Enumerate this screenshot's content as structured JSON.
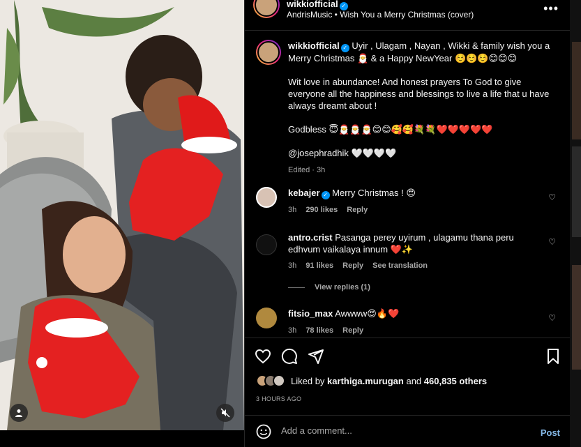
{
  "header": {
    "username": "wikkiofficial",
    "audio": "AndrisMusic • Wish You a Merry Christmas (cover)",
    "more_icon": "more-horizontal-icon"
  },
  "caption": {
    "username": "wikkiofficial",
    "line1": "Uyir , Ulagam , Nayan , Wikki & family wish you a Merry Christmas 🎅 & a Happy NewYear ☺️☺️☺️😊😊😊",
    "line2": "Wit love in abundance! And honest prayers To God to give everyone all the happiness and blessings to live a life that u have always dreamt about !",
    "line3": "Godbless 😇🎅🎅🎅😊😊🥰🥰💐💐❤️❤️❤️❤️❤️",
    "line4": "@josephradhik 🤍🤍🤍🤍",
    "edited": "Edited · 3h"
  },
  "comments": [
    {
      "username": "kebajer",
      "text": "Merry Christmas ! 😍",
      "time": "3h",
      "likes": "290 likes",
      "reply": "Reply"
    },
    {
      "username": "antro.crist",
      "text": "Pasanga perey uyirum , ulagamu thana peru edhvum vaikalaya innum ❤️✨",
      "time": "3h",
      "likes": "91 likes",
      "reply": "Reply",
      "translate": "See translation",
      "view_replies": "View replies (1)"
    },
    {
      "username": "fitsio_max",
      "text": "Awwww😍🔥❤️",
      "time": "3h",
      "likes": "78 likes",
      "reply": "Reply"
    }
  ],
  "likes": {
    "prefix": "Liked by",
    "user": "karthiga.murugan",
    "and": "and",
    "count": "460,835 others"
  },
  "time_ago": "3 HOURS AGO",
  "add_comment": {
    "placeholder": "Add a comment...",
    "post": "Post"
  },
  "colors": {
    "background": "#000000",
    "verified": "#0095f6",
    "post_button": "#85b8e6",
    "muted": "#a8a8a8"
  }
}
